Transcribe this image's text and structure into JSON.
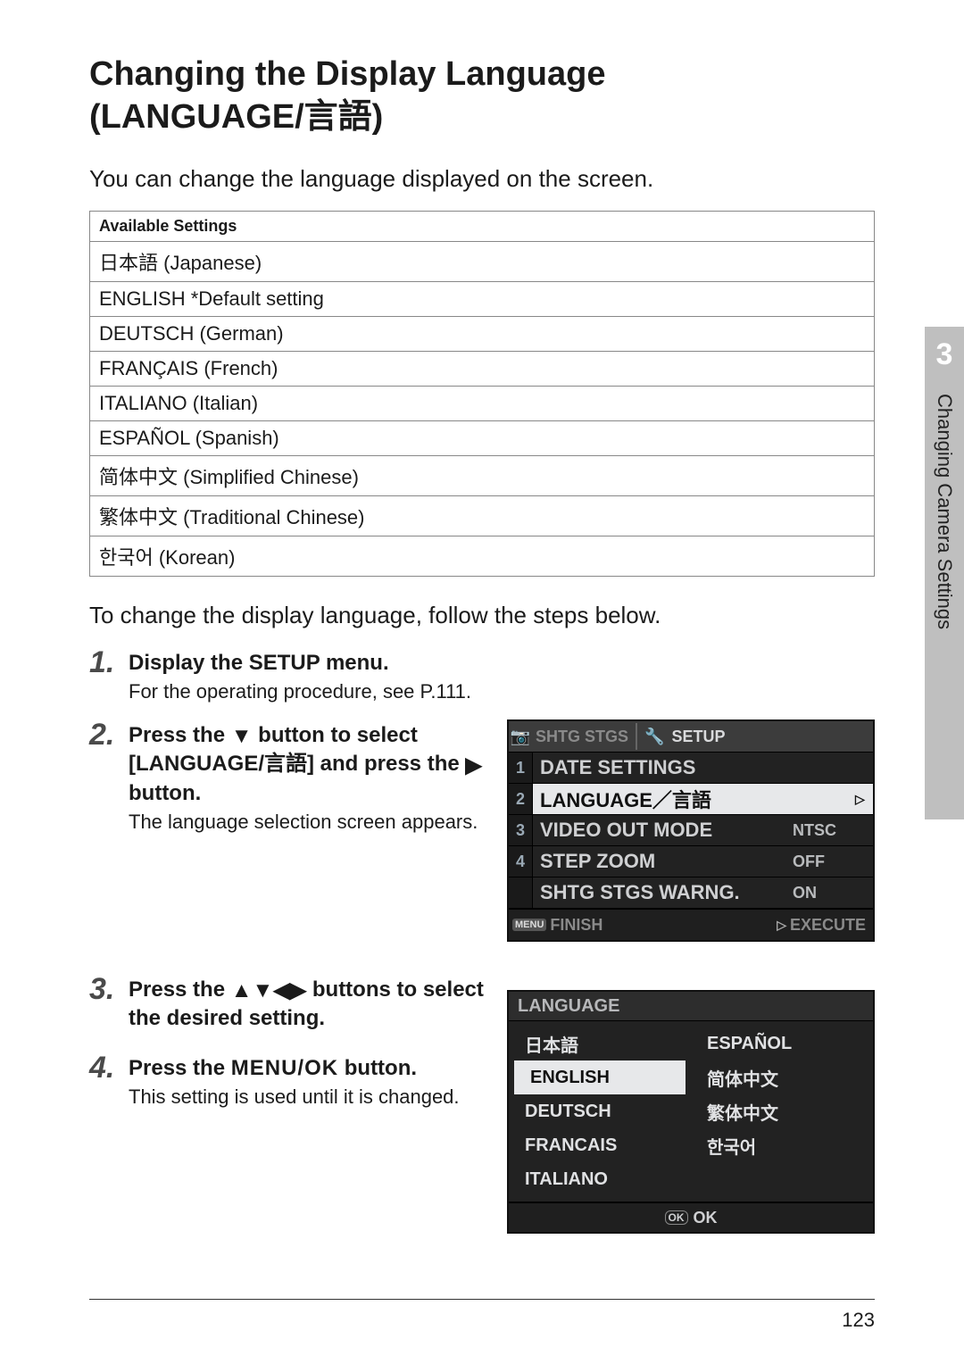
{
  "title_line1": "Changing the Display Language",
  "title_line2": "(LANGUAGE/言語)",
  "intro": "You can change the language displayed on the screen.",
  "settings_header": "Available Settings",
  "settings": [
    "日本語 (Japanese)",
    "ENGLISH *Default setting",
    "DEUTSCH (German)",
    "FRANÇAIS (French)",
    "ITALIANO (Italian)",
    "ESPAÑOL (Spanish)",
    "简体中文 (Simplified Chinese)",
    "繁体中文 (Traditional Chinese)",
    "한국어 (Korean)"
  ],
  "lead2": "To change the display language, follow the steps below.",
  "steps": {
    "s1_num": "1.",
    "s1_title": "Display the SETUP menu.",
    "s1_desc": "For the operating procedure, see P.111.",
    "s2_num": "2.",
    "s2_title_a": "Press the ",
    "s2_title_b": " button to select [LANGUAGE/言語] and press the ",
    "s2_title_c": " button.",
    "s2_desc": "The language selection screen appears.",
    "s3_num": "3.",
    "s3_title_a": "Press the ",
    "s3_title_b": " buttons to select the desired setting.",
    "s4_num": "4.",
    "s4_title_a": "Press the ",
    "s4_title_b": "MENU/OK",
    "s4_title_c": " button.",
    "s4_desc": "This setting is used until it is changed."
  },
  "cam1": {
    "tab_shtg": "SHTG STGS",
    "tab_setup": "SETUP",
    "rows": [
      {
        "n": "1",
        "label": "DATE SETTINGS",
        "val": "",
        "sel": false,
        "arrow": ""
      },
      {
        "n": "2",
        "label": "LANGUAGE／言語",
        "val": "",
        "sel": true,
        "arrow": "▷"
      },
      {
        "n": "3",
        "label": "VIDEO OUT MODE",
        "val": "NTSC",
        "sel": false,
        "arrow": ""
      },
      {
        "n": "4",
        "label": "STEP ZOOM",
        "val": "OFF",
        "sel": false,
        "arrow": ""
      },
      {
        "n": "",
        "label": "SHTG STGS WARNG.",
        "val": "ON",
        "sel": false,
        "arrow": ""
      }
    ],
    "footer_menu": "MENU",
    "footer_finish": "FINISH",
    "footer_execute": "EXECUTE"
  },
  "cam2": {
    "header": "LANGUAGE",
    "colA": [
      "日本語",
      "ENGLISH",
      "DEUTSCH",
      "FRANCAIS",
      "ITALIANO"
    ],
    "colB": [
      "ESPAÑOL",
      "简体中文",
      "繁体中文",
      "한국어"
    ],
    "selected": "ENGLISH",
    "ok_badge": "OK",
    "ok_label": "OK"
  },
  "side": {
    "chapter": "3",
    "label": "Changing Camera Settings"
  },
  "page_number": "123"
}
